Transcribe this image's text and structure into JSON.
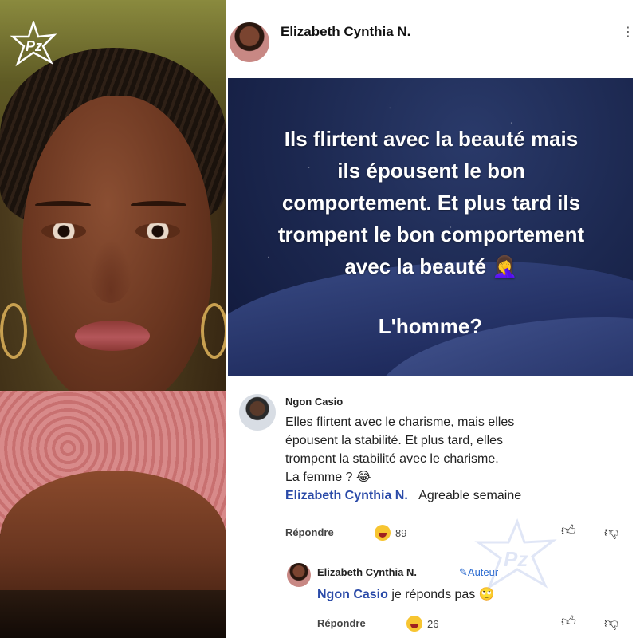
{
  "post": {
    "author": "Elizabeth Cynthia N.",
    "quote_lines": [
      "Ils flirtent avec la beauté mais",
      "ils épousent le bon",
      "comportement. Et plus tard ils",
      "trompent le bon comportement",
      "avec la beauté 🤦‍♀️"
    ],
    "quote_question": "L'homme?"
  },
  "comment": {
    "author": "Ngon Casio",
    "lines": [
      "Elles flirtent avec le charisme, mais elles",
      "épousent la stabilité. Et plus tard, elles",
      "trompent la stabilité avec le charisme.",
      "La femme ? 😂"
    ],
    "reply_mention": "Elizabeth Cynthia N.",
    "reply_text": "Agreable semaine",
    "reply_label": "Répondre",
    "reaction_count": "89"
  },
  "reply": {
    "author": "Elizabeth Cynthia N.",
    "badge": "Auteur",
    "mention": "Ngon Casio",
    "text": "je réponds pas 🙄",
    "reply_label": "Répondre",
    "reaction_count": "26"
  },
  "watermark": {
    "logo": "Pz"
  },
  "icons": {
    "like": "thumbs-up-icon",
    "dislike": "thumbs-down-icon",
    "pencil": "pencil-icon"
  },
  "colors": {
    "mention": "#2a4aa8",
    "badge": "#2a6ad0",
    "quote_bg": "#1c2850"
  }
}
